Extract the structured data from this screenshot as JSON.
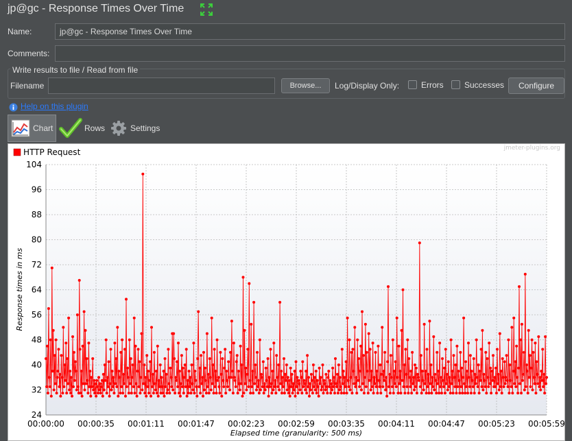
{
  "window": {
    "title": "jp@gc - Response Times Over Time"
  },
  "form": {
    "name_label": "Name:",
    "name_value": "jp@gc - Response Times Over Time",
    "comments_label": "Comments:",
    "comments_value": "",
    "file_group_label": "Write results to file / Read from file",
    "filename_label": "Filename",
    "filename_value": "",
    "browse_label": "Browse...",
    "log_display_label": "Log/Display Only:",
    "errors_label": "Errors",
    "errors_checked": false,
    "successes_label": "Successes",
    "successes_checked": false,
    "configure_label": "Configure"
  },
  "help": {
    "label": "Help on this plugin"
  },
  "tabs": [
    {
      "label": "Chart",
      "icon": "chart-icon",
      "active": true
    },
    {
      "label": "Rows",
      "icon": "checkmark-icon",
      "active": false
    },
    {
      "label": "Settings",
      "icon": "gear-icon",
      "active": false
    }
  ],
  "colors": {
    "series": "#ff0000",
    "background": "#4b4e50",
    "link": "#2b7bff"
  },
  "chart_data": {
    "type": "line",
    "watermark": "jmeter-plugins.org",
    "xlabel": "Elapsed time (granularity: 500 ms)",
    "ylabel": "Response times in ms",
    "ylim": [
      24,
      104
    ],
    "yticks": [
      24,
      32,
      40,
      48,
      56,
      64,
      72,
      80,
      88,
      96,
      104
    ],
    "xlim_seconds": [
      0,
      359
    ],
    "xtick_labels": [
      "00:00:00",
      "00:00:35",
      "00:01:11",
      "00:01:47",
      "00:02:23",
      "00:02:59",
      "00:03:35",
      "00:04:11",
      "00:04:47",
      "00:05:23",
      "00:05:59"
    ],
    "grid": true,
    "legend_position": "top-left",
    "series": [
      {
        "name": "HTTP Request",
        "color": "#ff0000",
        "granularity_seconds": 0.5,
        "values": [
          42,
          33,
          46,
          31,
          58,
          36,
          33,
          48,
          30,
          71,
          38,
          51,
          32,
          43,
          34,
          48,
          31,
          36,
          38,
          45,
          33,
          37,
          30,
          43,
          36,
          31,
          52,
          33,
          40,
          35,
          47,
          31,
          42,
          34,
          55,
          32,
          38,
          31,
          36,
          30,
          49,
          33,
          44,
          35,
          41,
          38,
          32,
          56,
          33,
          31,
          67,
          45,
          31,
          38,
          30,
          46,
          34,
          57,
          32,
          51,
          34,
          42,
          35,
          31,
          47,
          33,
          38,
          30,
          36,
          33,
          42,
          32,
          35,
          31,
          34,
          30,
          35,
          33,
          31,
          36,
          32,
          34,
          31,
          33,
          35,
          30,
          37,
          32,
          40,
          35,
          48,
          31,
          36,
          33,
          41,
          30,
          34,
          45,
          32,
          38,
          33,
          36,
          31,
          47,
          34,
          42,
          33,
          52,
          30,
          38,
          36,
          31,
          44,
          33,
          48,
          31,
          37,
          34,
          45,
          30,
          61,
          33,
          39,
          36,
          31,
          48,
          34,
          42,
          31,
          36,
          40,
          33,
          55,
          31,
          46,
          34,
          30,
          38,
          45,
          33,
          41,
          31,
          36,
          50,
          32,
          101,
          34,
          40,
          31,
          36,
          30,
          43,
          33,
          38,
          31,
          35,
          41,
          30,
          52,
          33,
          37,
          31,
          44,
          34,
          32,
          38,
          31,
          46,
          30,
          35,
          33,
          40,
          31,
          36,
          33,
          31,
          38,
          30,
          42,
          33,
          37,
          31,
          32,
          45,
          34,
          31,
          39,
          36,
          33,
          50,
          32,
          50,
          42,
          31,
          36,
          35,
          41,
          33,
          47,
          31,
          38,
          30,
          34,
          43,
          33,
          39,
          31,
          36,
          40,
          33,
          45,
          30,
          35,
          31,
          38,
          33,
          36,
          31,
          40,
          34,
          32,
          47,
          31,
          38,
          35,
          33,
          30,
          42,
          57,
          33,
          39,
          31,
          43,
          34,
          36,
          30,
          44,
          32,
          39,
          35,
          31,
          50,
          33,
          37,
          31,
          42,
          36,
          32,
          55,
          34,
          40,
          31,
          45,
          33,
          38,
          31,
          48,
          35,
          36,
          33,
          31,
          44,
          37,
          30,
          42,
          35,
          33,
          39,
          45,
          31,
          38,
          35,
          33,
          41,
          36,
          32,
          44,
          36,
          54,
          38,
          31,
          47,
          36,
          35,
          33,
          41,
          43,
          31,
          38,
          34,
          32,
          46,
          34,
          40,
          30,
          68,
          31,
          51,
          34,
          39,
          32,
          37,
          45,
          33,
          66,
          35,
          31,
          53,
          33,
          38,
          31,
          60,
          34,
          40,
          36,
          32,
          44,
          33,
          35,
          31,
          48,
          32,
          37,
          36,
          33,
          41,
          31,
          34,
          32,
          39,
          35,
          33,
          42,
          30,
          36,
          33,
          45,
          34,
          31,
          38,
          32,
          47,
          33,
          35,
          31,
          43,
          36,
          33,
          40,
          32,
          60,
          34,
          38,
          31,
          36,
          33,
          42,
          31,
          37,
          35,
          40,
          32,
          36,
          31,
          35,
          30,
          39,
          33,
          37,
          31,
          34,
          32,
          38,
          30,
          41,
          33,
          36,
          31,
          35,
          34,
          32,
          38,
          36,
          31,
          41,
          33,
          35,
          34,
          32,
          38,
          31,
          43,
          33,
          36,
          30,
          34,
          32,
          37,
          35,
          31,
          40,
          33,
          36,
          32,
          38,
          31,
          35,
          33,
          30,
          39,
          34,
          36,
          32,
          33,
          40,
          31,
          35,
          34,
          32,
          37,
          33,
          31,
          36,
          38,
          33,
          35,
          31,
          34,
          32,
          39,
          33,
          36,
          31,
          42,
          34,
          33,
          37,
          31,
          40,
          32,
          36,
          33,
          31,
          45,
          34,
          38,
          31,
          36,
          33,
          41,
          31,
          55,
          35,
          33,
          48,
          32,
          36,
          44,
          31,
          45,
          38,
          34,
          52,
          33,
          36,
          31,
          48,
          35,
          42,
          33,
          38,
          46,
          32,
          57,
          34,
          43,
          31,
          36,
          53,
          33,
          44,
          38,
          31,
          50,
          35,
          45,
          32,
          38,
          33,
          47,
          31,
          36,
          34,
          44,
          33,
          38,
          31,
          46,
          35,
          33,
          40,
          31,
          37,
          52,
          33,
          38,
          35,
          44,
          32,
          36,
          30,
          41,
          65,
          33,
          37,
          31,
          43,
          36,
          33,
          48,
          31,
          38,
          34,
          41,
          33,
          55,
          36,
          31,
          46,
          34,
          38,
          31,
          51,
          35,
          64,
          33,
          40,
          31,
          45,
          37,
          33,
          48,
          31,
          42,
          36,
          33,
          38,
          31,
          44,
          34,
          36,
          32,
          40,
          33,
          39,
          31,
          37,
          36,
          35,
          79,
          33,
          43,
          31,
          38,
          35,
          32,
          53,
          34,
          38,
          31,
          45,
          33,
          37,
          31,
          54,
          34,
          40,
          31,
          36,
          33,
          49,
          32,
          37,
          35,
          31,
          44,
          34,
          38,
          31,
          47,
          33,
          36,
          31,
          42,
          35,
          33,
          39,
          31,
          45,
          34,
          37,
          32,
          41,
          33,
          36,
          31,
          48,
          34,
          38,
          31,
          43,
          36,
          33,
          40,
          31,
          46,
          33,
          38,
          35,
          31,
          44,
          33,
          39,
          31,
          36,
          55,
          34,
          31,
          41,
          33,
          38,
          31,
          47,
          36,
          33,
          43,
          31,
          38,
          35,
          33,
          42,
          31,
          37,
          34,
          48,
          36,
          33,
          40,
          31,
          38,
          35,
          45,
          33,
          51,
          32,
          37,
          35,
          33,
          44,
          31,
          42,
          36,
          33,
          47,
          34,
          39,
          31,
          38,
          35,
          43,
          33,
          36,
          33,
          39,
          31,
          45,
          34,
          37,
          32,
          50,
          33,
          38,
          31,
          42,
          36,
          33,
          41,
          34,
          36,
          43,
          35,
          33,
          48,
          31,
          40,
          35,
          33,
          52,
          31,
          38,
          55,
          34,
          41,
          33,
          46,
          36,
          31,
          39,
          65,
          34,
          48,
          31,
          53,
          35,
          37,
          44,
          32,
          69,
          33,
          40,
          38,
          31,
          51,
          36,
          43,
          33,
          39,
          48,
          32,
          44,
          36,
          34,
          47,
          31,
          41,
          37,
          34,
          49,
          33,
          36,
          32,
          38,
          35,
          45,
          33,
          37,
          31,
          49,
          34,
          36
        ]
      }
    ]
  }
}
